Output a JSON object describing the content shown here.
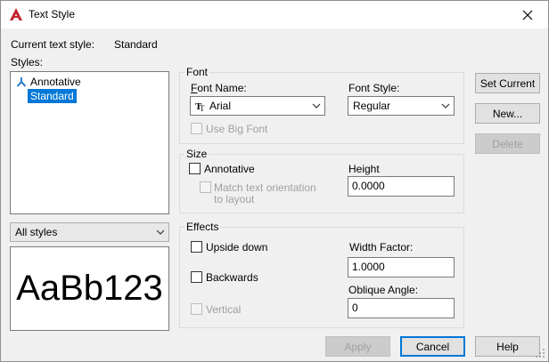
{
  "window": {
    "title": "Text Style",
    "accent_color": "#c1272d"
  },
  "current_style": {
    "label": "Current text style:",
    "value": "Standard"
  },
  "styles": {
    "label": "Styles:",
    "items": [
      {
        "label": "Annotative",
        "icon": "annotative-icon",
        "selected": false
      },
      {
        "label": "Standard",
        "selected": true
      }
    ],
    "filter_selected": "All styles"
  },
  "preview": {
    "text": "AaBb123"
  },
  "font": {
    "group_title": "Font",
    "font_name_label": "Font Name:",
    "font_name_value": "Arial",
    "font_name_icon": "truetype-icon",
    "font_style_label": "Font Style:",
    "font_style_value": "Regular",
    "use_big_font_label": "Use Big Font"
  },
  "size": {
    "group_title": "Size",
    "annotative_label": "Annotative",
    "match_orientation_label_1": "Match text orientation",
    "match_orientation_label_2": "to layout",
    "height_label": "Height",
    "height_value": "0.0000"
  },
  "effects": {
    "group_title": "Effects",
    "upside_down_label": "Upside down",
    "backwards_label": "Backwards",
    "vertical_label": "Vertical",
    "width_factor_label": "Width Factor:",
    "width_factor_value": "1.0000",
    "oblique_angle_label": "Oblique Angle:",
    "oblique_angle_value": "0"
  },
  "buttons": {
    "set_current": "Set Current",
    "new": "New...",
    "delete": "Delete",
    "apply": "Apply",
    "cancel": "Cancel",
    "help": "Help"
  },
  "colors": {
    "selection": "#0078d7",
    "default_button_border": "#0078d7"
  }
}
